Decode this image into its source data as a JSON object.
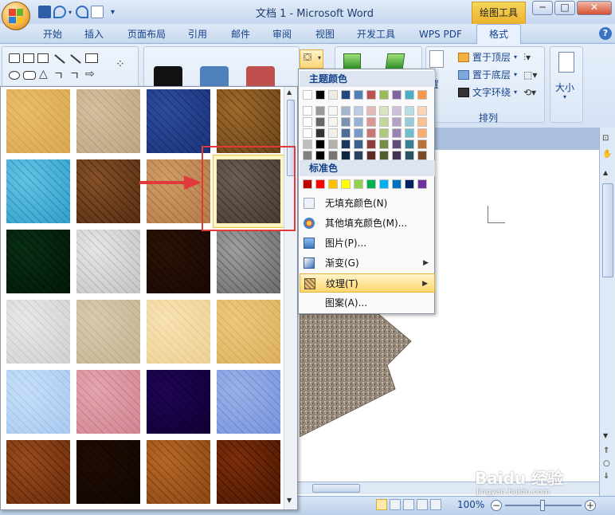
{
  "window": {
    "title": "文档 1 - Microsoft Word",
    "context_tab_group": "绘图工具",
    "controls": [
      "─",
      "□",
      "✕"
    ]
  },
  "tabs": [
    "开始",
    "插入",
    "页面布局",
    "引用",
    "邮件",
    "审阅",
    "视图",
    "开发工具",
    "WPS PDF",
    "格式"
  ],
  "active_tab": "格式",
  "ribbon": {
    "arrange_group_label": "排列",
    "bring_front": "置于顶层",
    "send_back": "置于底层",
    "wrap_text": "文字环绕",
    "size_label": "大小",
    "set_partial": "置"
  },
  "color_menu": {
    "theme_header": "主题颜色",
    "standard_header": "标准色",
    "items": [
      {
        "label": "无填充颜色(N)",
        "icon": "no-fill-icon",
        "submenu": false
      },
      {
        "label": "其他填充颜色(M)...",
        "icon": "palette-icon",
        "submenu": false
      },
      {
        "label": "图片(P)...",
        "icon": "picture-icon",
        "submenu": false
      },
      {
        "label": "渐变(G)",
        "icon": "gradient-icon",
        "submenu": true
      },
      {
        "label": "纹理(T)",
        "icon": "texture-icon",
        "submenu": true,
        "highlighted": true
      },
      {
        "label": "图案(A)...",
        "icon": "pattern-icon",
        "submenu": false
      }
    ],
    "theme_top_row": [
      "#ffffff",
      "#000000",
      "#eeece1",
      "#1f497d",
      "#4f81bd",
      "#c0504d",
      "#9bbb59",
      "#8064a2",
      "#4bacc6",
      "#f79646"
    ],
    "standard_colors": [
      "#c00000",
      "#ff0000",
      "#ffc000",
      "#ffff00",
      "#92d050",
      "#00b050",
      "#00b0f0",
      "#0070c0",
      "#002060",
      "#7030a0"
    ]
  },
  "textures": [
    {
      "name": "papyrus",
      "colors": [
        "#f4dca4",
        "#e3c483"
      ]
    },
    {
      "name": "canvas",
      "colors": [
        "#e9ddc9",
        "#cfc1aa"
      ]
    },
    {
      "name": "denim",
      "colors": [
        "#6d8cc6",
        "#3f5fa0"
      ]
    },
    {
      "name": "woven-mat",
      "colors": [
        "#c9a56b",
        "#8a6a3c"
      ]
    },
    {
      "name": "water-droplets",
      "colors": [
        "#9fdff0",
        "#56b6d6"
      ]
    },
    {
      "name": "paper-bag",
      "colors": [
        "#b89066",
        "#7a5331"
      ]
    },
    {
      "name": "fish-fossil",
      "colors": [
        "#e6c8a2",
        "#c79f74"
      ]
    },
    {
      "name": "sand",
      "colors": [
        "#a59c92",
        "#6e6359"
      ]
    },
    {
      "name": "green-marble",
      "colors": [
        "#2e6e48",
        "#0e3a22"
      ]
    },
    {
      "name": "white-marble",
      "colors": [
        "#f2f2f2",
        "#cfcfcf"
      ]
    },
    {
      "name": "brown-marble",
      "colors": [
        "#6a4428",
        "#3b2312"
      ]
    },
    {
      "name": "granite",
      "colors": [
        "#c9c9c9",
        "#8a8a8a"
      ]
    },
    {
      "name": "newsprint",
      "colors": [
        "#f3f3f3",
        "#dcdcdc"
      ]
    },
    {
      "name": "recycled-paper",
      "colors": [
        "#eae3d3",
        "#d7ccb4"
      ]
    },
    {
      "name": "parchment",
      "colors": [
        "#fbf0d6",
        "#f1dfb4"
      ]
    },
    {
      "name": "stationery",
      "colors": [
        "#f6e2b3",
        "#e4c98a"
      ]
    },
    {
      "name": "blue-tissue-paper",
      "colors": [
        "#e1eefc",
        "#c2d9f2"
      ]
    },
    {
      "name": "pink-tissue-paper",
      "colors": [
        "#f1cdd3",
        "#dda8b3"
      ]
    },
    {
      "name": "purple-mesh",
      "colors": [
        "#5b1f95",
        "#2f0a5c"
      ]
    },
    {
      "name": "bouquet",
      "colors": [
        "#c7d4f2",
        "#9db4e8"
      ]
    },
    {
      "name": "cork",
      "colors": [
        "#c58a55",
        "#8c5428"
      ]
    },
    {
      "name": "walnut",
      "colors": [
        "#5c3a20",
        "#2e1b0e"
      ]
    },
    {
      "name": "oak",
      "colors": [
        "#d7a363",
        "#a8713a"
      ]
    },
    {
      "name": "medium-wood",
      "colors": [
        "#b36d33",
        "#6e3a14"
      ]
    }
  ],
  "selected_texture_index": 7,
  "status_bar": {
    "zoom": "100%"
  },
  "watermark": {
    "logo": "Baidu 经验",
    "url": "jingyan.baidu.com"
  }
}
